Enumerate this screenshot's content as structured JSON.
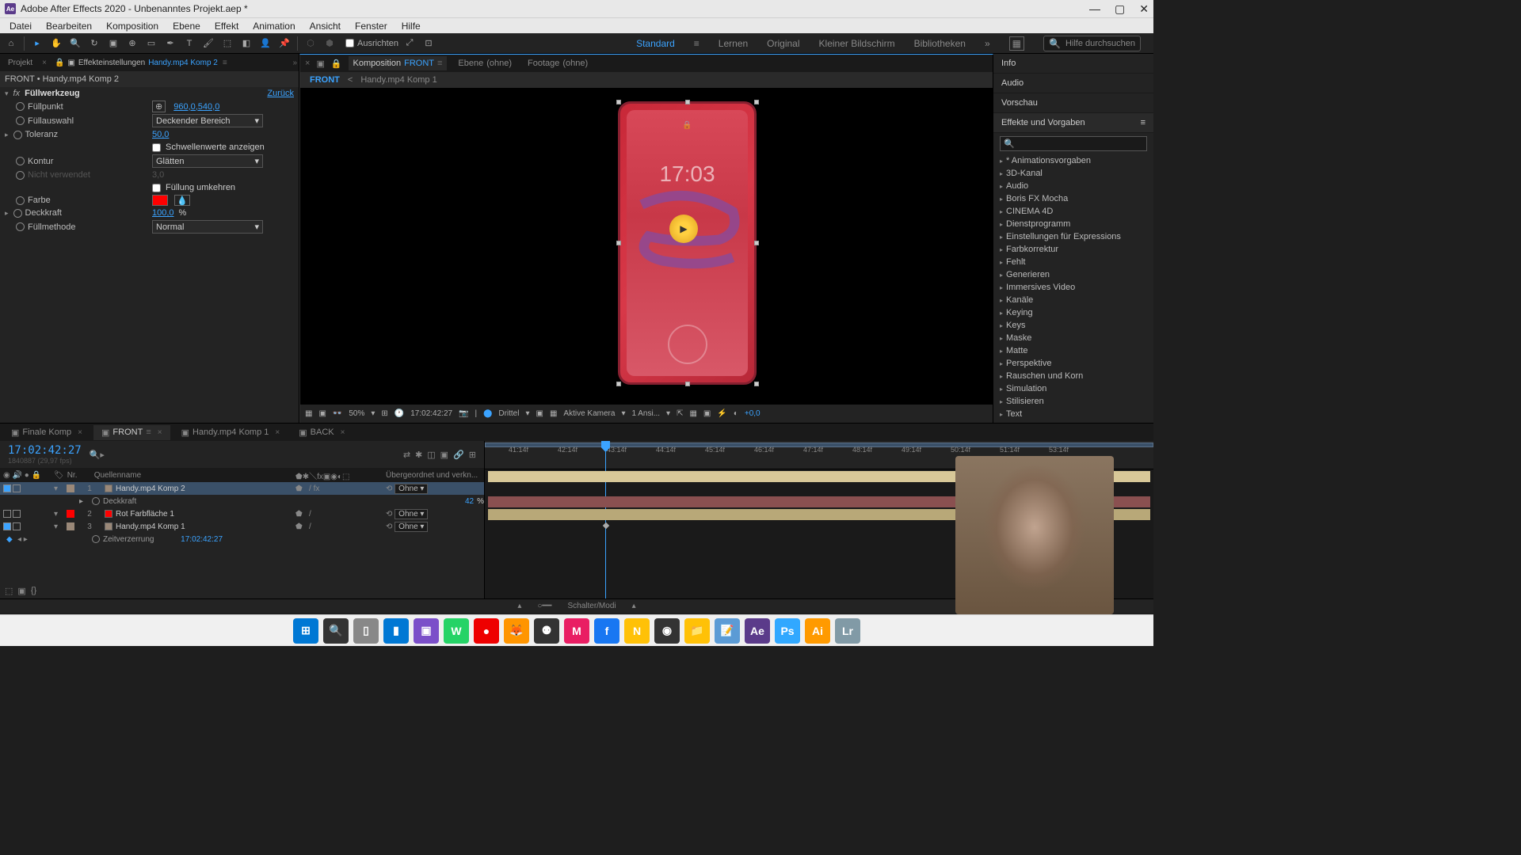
{
  "titlebar": {
    "app": "Ae",
    "title": "Adobe After Effects 2020 - Unbenanntes Projekt.aep *"
  },
  "menubar": [
    "Datei",
    "Bearbeiten",
    "Komposition",
    "Ebene",
    "Effekt",
    "Animation",
    "Ansicht",
    "Fenster",
    "Hilfe"
  ],
  "toolbar": {
    "align_label": "Ausrichten",
    "search_placeholder": "Hilfe durchsuchen"
  },
  "workspaces": {
    "items": [
      "Standard",
      "Lernen",
      "Original",
      "Kleiner Bildschirm",
      "Bibliotheken"
    ],
    "active": "Standard"
  },
  "left_panel": {
    "tabs": {
      "project": "Projekt",
      "settings": "Effekteinstellungen",
      "comp": "Handy.mp4 Komp 2"
    },
    "breadcrumb": "FRONT • Handy.mp4 Komp 2",
    "effect": {
      "name": "Füllwerkzeug",
      "reset": "Zurück",
      "rows": [
        {
          "lbl": "Füllpunkt",
          "val": "960,0,540,0",
          "icon": true
        },
        {
          "lbl": "Füllauswahl",
          "dropdown": "Deckender Bereich"
        },
        {
          "lbl": "Toleranz",
          "link": "50,0",
          "arrow": true
        },
        {
          "lbl": "",
          "check": "Schwellenwerte anzeigen"
        },
        {
          "lbl": "Kontur",
          "dropdown": "Glätten"
        },
        {
          "lbl": "Nicht verwendet",
          "disabled": true,
          "val": "3,0"
        },
        {
          "lbl": "",
          "check": "Füllung umkehren"
        },
        {
          "lbl": "Farbe",
          "color": "#ff0000"
        },
        {
          "lbl": "Deckkraft",
          "link": "100,0",
          "suffix": "%",
          "arrow": true
        },
        {
          "lbl": "Füllmethode",
          "dropdown": "Normal"
        }
      ]
    }
  },
  "center": {
    "tabs": [
      {
        "pre": "Komposition",
        "name": "FRONT",
        "active": true
      },
      {
        "pre": "Ebene",
        "name": "(ohne)"
      },
      {
        "pre": "Footage",
        "name": "(ohne)"
      }
    ],
    "breadcrumb": [
      "FRONT",
      "<",
      "Handy.mp4 Komp 1"
    ],
    "phone_time": "17:03",
    "status": {
      "zoom": "50%",
      "time": "17:02:42:27",
      "resolution": "Drittel",
      "camera": "Aktive Kamera",
      "views": "1 Ansi...",
      "exposure": "+0,0"
    }
  },
  "right_panel": {
    "sections": [
      "Info",
      "Audio",
      "Vorschau"
    ],
    "effects_title": "Effekte und Vorgaben",
    "categories": [
      "* Animationsvorgaben",
      "3D-Kanal",
      "Audio",
      "Boris FX Mocha",
      "CINEMA 4D",
      "Dienstprogramm",
      "Einstellungen für Expressions",
      "Farbkorrektur",
      "Fehlt",
      "Generieren",
      "Immersives Video",
      "Kanäle",
      "Keying",
      "Keys",
      "Maske",
      "Matte",
      "Perspektive",
      "Rauschen und Korn",
      "Simulation",
      "Stilisieren",
      "Text"
    ]
  },
  "timeline": {
    "tabs": [
      {
        "name": "Finale Komp"
      },
      {
        "name": "FRONT",
        "active": true
      },
      {
        "name": "Handy.mp4 Komp 1"
      },
      {
        "name": "BACK"
      }
    ],
    "timecode": "17:02:42:27",
    "fps": "1840887 (29,97 fps)",
    "headers": {
      "nr": "Nr.",
      "name": "Quellenname",
      "parent": "Übergeordnet und verkn..."
    },
    "layers": [
      {
        "nr": "1",
        "name": "Handy.mp4 Komp 2",
        "selected": true,
        "vis": true,
        "solo": false,
        "color": "#9a8878",
        "fx": true,
        "parent": "Ohne"
      },
      {
        "prop": "Deckkraft",
        "val": "42",
        "suffix": "%"
      },
      {
        "nr": "2",
        "name": "Rot Farbfläche 1",
        "vis": false,
        "color": "#ff0000",
        "parent": "Ohne"
      },
      {
        "nr": "3",
        "name": "Handy.mp4 Komp 1",
        "vis": true,
        "color": "#9a8878",
        "parent": "Ohne"
      },
      {
        "prop": "Zeitverzerrung",
        "val": "17:02:42:27",
        "kf": true
      }
    ],
    "ruler": [
      "41:14f",
      "42:14f",
      "43:14f",
      "44:14f",
      "45:14f",
      "46:14f",
      "47:14f",
      "48:14f",
      "49:14f",
      "50:14f",
      "51:14f",
      "53:14f"
    ],
    "footer": "Schalter/Modi"
  },
  "taskbar": [
    {
      "c": "#0078d4",
      "t": "⊞"
    },
    {
      "c": "#333",
      "t": "🔍"
    },
    {
      "c": "#888",
      "t": "▯"
    },
    {
      "c": "#0078d4",
      "t": "▮"
    },
    {
      "c": "#7b4fc9",
      "t": "▣"
    },
    {
      "c": "#25d366",
      "t": "W"
    },
    {
      "c": "#e00",
      "t": "●"
    },
    {
      "c": "#ff9500",
      "t": "🦊"
    },
    {
      "c": "#333",
      "t": "⚉"
    },
    {
      "c": "#e91e63",
      "t": "M"
    },
    {
      "c": "#1877f2",
      "t": "f"
    },
    {
      "c": "#ffc107",
      "t": "N"
    },
    {
      "c": "#333",
      "t": "◉"
    },
    {
      "c": "#ffc107",
      "t": "📁"
    },
    {
      "c": "#5b9bd5",
      "t": "📝"
    },
    {
      "c": "#5b3b8a",
      "t": "Ae"
    },
    {
      "c": "#31a8ff",
      "t": "Ps"
    },
    {
      "c": "#ff9a00",
      "t": "Ai"
    },
    {
      "c": "#819aa6",
      "t": "Lr"
    }
  ]
}
